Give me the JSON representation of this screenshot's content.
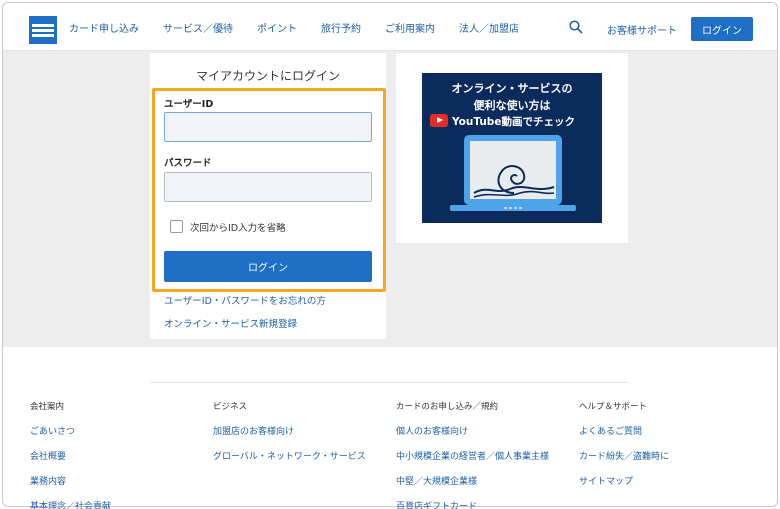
{
  "header": {
    "nav": [
      "カード申し込み",
      "サービス／優待",
      "ポイント",
      "旅行予約",
      "ご利用案内",
      "法人／加盟店"
    ],
    "support": "お客様サポート",
    "login": "ログイン"
  },
  "login_card": {
    "title": "マイアカウントにログイン",
    "user_label": "ユーザーID",
    "user_value": "",
    "password_label": "パスワード",
    "password_value": "",
    "remember_label": "次回からID入力を省略",
    "login_button": "ログイン",
    "forgot_link": "ユーザーID・パスワードをお忘れの方",
    "register_link": "オンライン・サービス新規登録"
  },
  "promo": {
    "line1": "オンライン・サービスの",
    "line2": "便利な使い方は",
    "line3": "YouTube動画でチェック"
  },
  "footer": {
    "columns": [
      {
        "heading": "会社案内",
        "links": [
          "ごあいさつ",
          "会社概要",
          "業務内容",
          "基本理念／社会貢献"
        ]
      },
      {
        "heading": "ビジネス",
        "links": [
          "加盟店のお客様向け",
          "グローバル・ネットワーク・サービス"
        ]
      },
      {
        "heading": "カードのお申し込み／規約",
        "links": [
          "個人のお客様向け",
          "中小規模企業の経営者／個人事業主様",
          "中堅／大規模企業様",
          "百貨店ギフトカード"
        ]
      },
      {
        "heading": "ヘルプ＆サポート",
        "links": [
          "よくあるご質問",
          "カード紛失／盗難時に",
          "サイトマップ"
        ]
      }
    ]
  },
  "colors": {
    "brand_blue": "#1f6fc6",
    "highlight_orange": "#f5a623",
    "promo_navy": "#0b2b5c"
  }
}
